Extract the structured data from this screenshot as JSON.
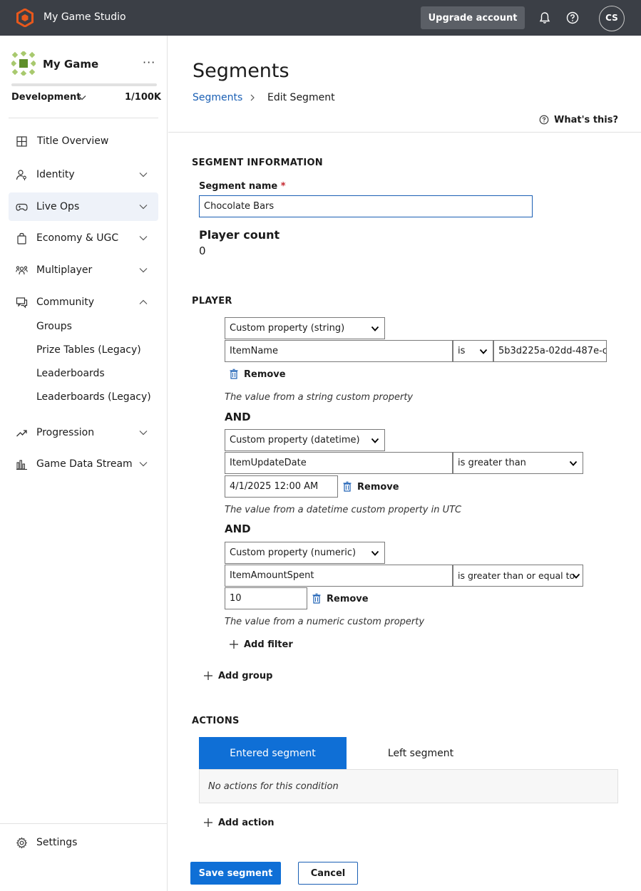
{
  "topbar": {
    "studio_name": "My Game Studio",
    "upgrade_label": "Upgrade account",
    "avatar_initials": "CS",
    "brand_color": "#e8581c"
  },
  "sidebar": {
    "game_name": "My Game",
    "more_label": "···",
    "environment": "Development",
    "quota": "1/100K",
    "quota_fraction": 1e-05,
    "items": [
      {
        "label": "Title Overview",
        "icon": "grid-icon",
        "expandable": false
      },
      {
        "label": "Identity",
        "icon": "person-key-icon",
        "expandable": true
      },
      {
        "label": "Live Ops",
        "icon": "gamepad-icon",
        "expandable": true,
        "active": true
      },
      {
        "label": "Economy & UGC",
        "icon": "shopping-bag-icon",
        "expandable": true
      },
      {
        "label": "Multiplayer",
        "icon": "people-icon",
        "expandable": true
      },
      {
        "label": "Community",
        "icon": "chat-icon",
        "expandable": true,
        "expanded": true
      },
      {
        "label": "Progression",
        "icon": "trend-up-icon",
        "expandable": true
      },
      {
        "label": "Game Data Stream",
        "icon": "bar-chart-icon",
        "expandable": true
      }
    ],
    "community_subitems": [
      "Groups",
      "Prize Tables (Legacy)",
      "Leaderboards",
      "Leaderboards (Legacy)"
    ],
    "settings_label": "Settings"
  },
  "main": {
    "page_title": "Segments",
    "breadcrumb": {
      "link": "Segments",
      "current": "Edit Segment"
    },
    "whats_this": "What's this?",
    "segment_info": {
      "heading": "SEGMENT INFORMATION",
      "name_label": "Segment name",
      "required_mark": "*",
      "name_value": "Chocolate Bars",
      "player_count_label": "Player count",
      "player_count_value": "0"
    },
    "player": {
      "heading": "PLAYER",
      "and_label": "AND",
      "remove_label": "Remove",
      "filters": [
        {
          "type": "Custom property (string)",
          "property": "ItemName",
          "operator": "is",
          "value": "5b3d225a-02dd-487e-c",
          "hint": "The value from a string custom property"
        },
        {
          "type": "Custom property (datetime)",
          "property": "ItemUpdateDate",
          "operator": "is greater than",
          "value": "4/1/2025 12:00 AM",
          "hint": "The value from a datetime custom property in UTC"
        },
        {
          "type": "Custom property (numeric)",
          "property": "ItemAmountSpent",
          "operator": "is greater than or equal to",
          "value": "10",
          "hint": "The value from a numeric custom property"
        }
      ],
      "add_filter_label": "Add filter",
      "add_group_label": "Add group"
    },
    "actions": {
      "heading": "ACTIONS",
      "tabs": [
        "Entered segment",
        "Left segment"
      ],
      "empty_text": "No actions for this condition",
      "add_action_label": "Add action"
    },
    "buttons": {
      "save": "Save segment",
      "cancel": "Cancel"
    }
  }
}
